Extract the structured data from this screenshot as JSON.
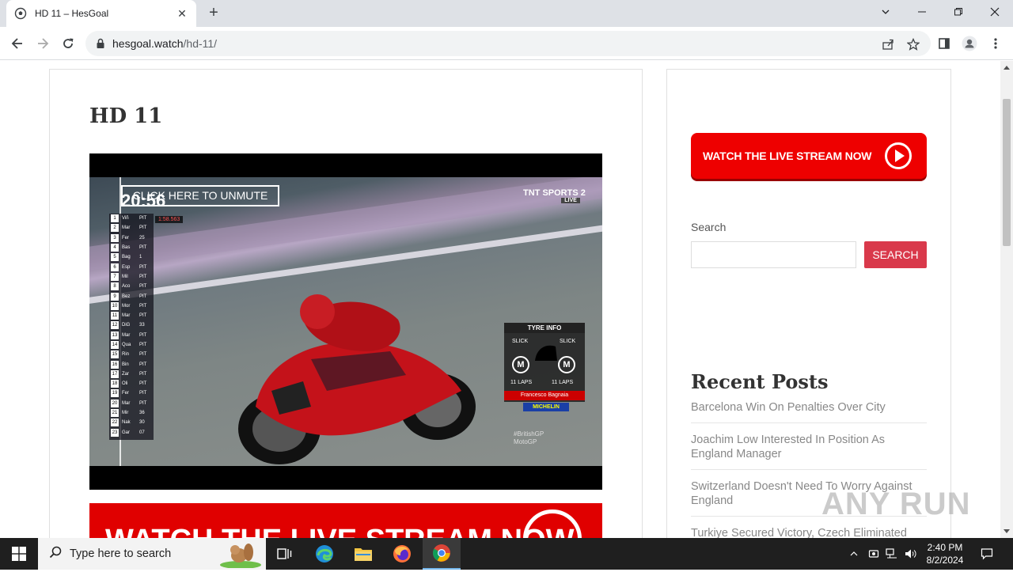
{
  "browser": {
    "tab_title": "HD 11 – HesGoal",
    "new_tab_symbol": "+",
    "close_tab_symbol": "✕",
    "url_domain": "hesgoal.watch",
    "url_path": "/hd-11/"
  },
  "page": {
    "title": "HD 11",
    "player": {
      "unmute_label": "CLICK HERE TO UNMUTE",
      "clock": "20:56",
      "broadcaster": "TNT SPORTS 2",
      "broadcaster_badge": "LIVE",
      "gap_time": "1:58.563",
      "leaderboard": [
        {
          "pos": "1",
          "rider": "Viñ",
          "status": "PIT"
        },
        {
          "pos": "2",
          "rider": "Mar",
          "status": "PIT"
        },
        {
          "pos": "3",
          "rider": "Fer",
          "status": "25"
        },
        {
          "pos": "4",
          "rider": "Bas",
          "status": "PIT"
        },
        {
          "pos": "5",
          "rider": "Bag",
          "status": "1"
        },
        {
          "pos": "6",
          "rider": "Esp",
          "status": "PIT"
        },
        {
          "pos": "7",
          "rider": "Mil",
          "status": "PIT"
        },
        {
          "pos": "8",
          "rider": "Aco",
          "status": "PIT"
        },
        {
          "pos": "9",
          "rider": "Bez",
          "status": "PIT"
        },
        {
          "pos": "10",
          "rider": "Mor",
          "status": "PIT"
        },
        {
          "pos": "11",
          "rider": "Mar",
          "status": "PIT"
        },
        {
          "pos": "12",
          "rider": "DiG",
          "status": "33"
        },
        {
          "pos": "13",
          "rider": "Mar",
          "status": "PIT"
        },
        {
          "pos": "14",
          "rider": "Qua",
          "status": "PIT"
        },
        {
          "pos": "15",
          "rider": "Rin",
          "status": "PIT"
        },
        {
          "pos": "16",
          "rider": "Bin",
          "status": "PIT"
        },
        {
          "pos": "17",
          "rider": "Zar",
          "status": "PIT"
        },
        {
          "pos": "18",
          "rider": "Oli",
          "status": "PIT"
        },
        {
          "pos": "19",
          "rider": "Fer",
          "status": "PIT"
        },
        {
          "pos": "20",
          "rider": "Mar",
          "status": "PIT"
        },
        {
          "pos": "21",
          "rider": "Mir",
          "status": "36"
        },
        {
          "pos": "22",
          "rider": "Nak",
          "status": "30"
        },
        {
          "pos": "23",
          "rider": "Gar",
          "status": "07"
        }
      ],
      "tyre_info": {
        "header": "TYRE INFO",
        "front_type": "SLICK",
        "rear_type": "SLICK",
        "front_compound": "M",
        "rear_compound": "M",
        "front_laps": "11 LAPS",
        "rear_laps": "11 LAPS",
        "rider_name": "Francesco Bagnaia",
        "sponsor": "MICHELIN"
      },
      "event_tag": "#BritishGP",
      "series_tag": "MotoGP"
    },
    "banner_text": "WATCH THE LIVE STREAM NOW"
  },
  "sidebar": {
    "live_button_label": "WATCH THE LIVE STREAM NOW",
    "search_label": "Search",
    "search_button": "SEARCH",
    "search_placeholder": "",
    "recent_heading": "Recent Posts",
    "recent_posts": [
      "Barcelona Win On Penalties Over City",
      "Joachim Low Interested In Position As England Manager",
      "Switzerland Doesn't Need To Worry Against England",
      "Turkiye Secured Victory, Czech Eliminated"
    ]
  },
  "watermark": "ANY RUN",
  "taskbar": {
    "search_placeholder": "Type here to search",
    "time": "2:40 PM",
    "date": "8/2/2024"
  },
  "colors": {
    "accent_red": "#ee0000",
    "search_button": "#d9394b",
    "browser_frame": "#dee1e6"
  }
}
